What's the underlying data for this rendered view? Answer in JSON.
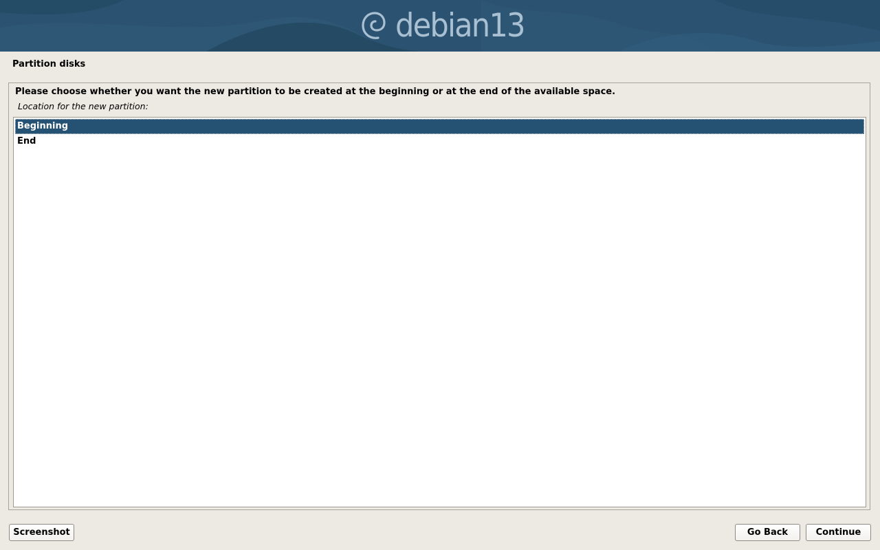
{
  "banner": {
    "logo_text": "debian13",
    "logo_icon": "debian-swirl-icon"
  },
  "page": {
    "title": "Partition disks"
  },
  "dialog": {
    "question": "Please choose whether you want the new partition to be created at the beginning or at the end of the available space.",
    "list_label": "Location for the new partition:",
    "options": [
      {
        "label": "Beginning",
        "selected": true
      },
      {
        "label": "End",
        "selected": false
      }
    ]
  },
  "buttons": {
    "screenshot": "Screenshot",
    "go_back": "Go Back",
    "continue": "Continue"
  },
  "colors": {
    "banner_background": "#2c5470",
    "selection": "#255272",
    "page_background": "#edeae4"
  }
}
